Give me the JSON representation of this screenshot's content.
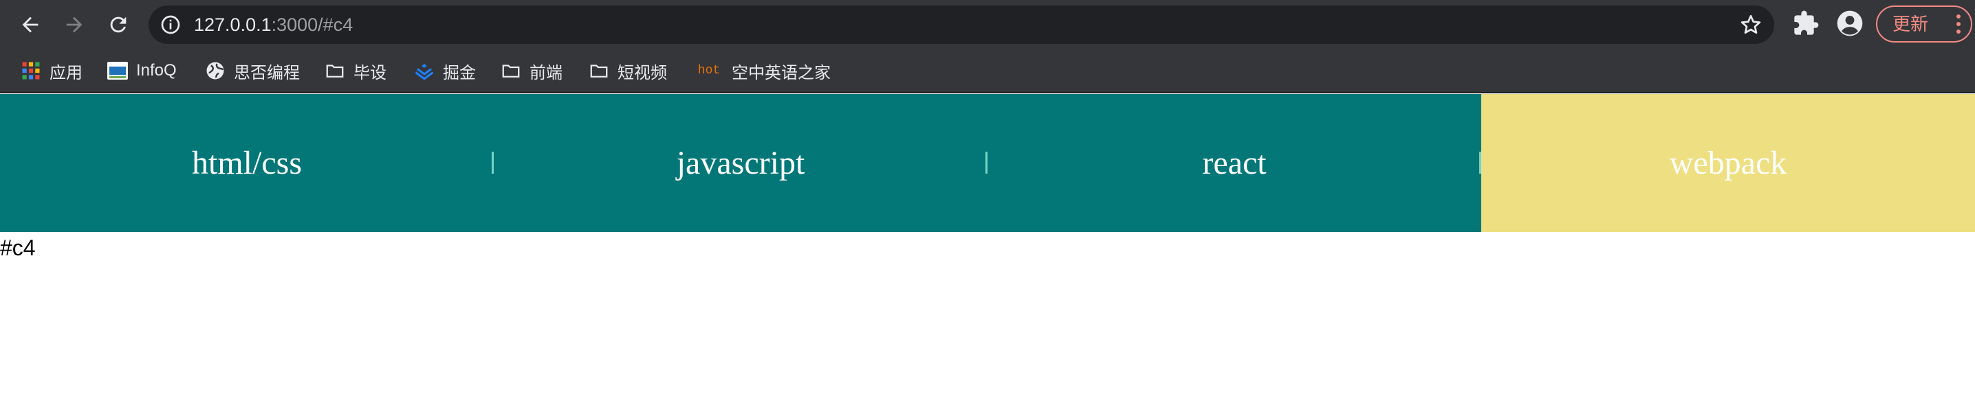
{
  "browser": {
    "url_host": "127.0.0.1",
    "url_rest": ":3000/#c4",
    "update_label": "更新",
    "bookmarks": [
      {
        "label": "应用",
        "icon": "apps-grid-icon"
      },
      {
        "label": "InfoQ",
        "icon": "infoq-icon"
      },
      {
        "label": "思否编程",
        "icon": "globe-icon"
      },
      {
        "label": "毕设",
        "icon": "folder-icon"
      },
      {
        "label": "掘金",
        "icon": "juejin-icon"
      },
      {
        "label": "前端",
        "icon": "folder-icon"
      },
      {
        "label": "短视频",
        "icon": "folder-icon"
      },
      {
        "label": "空中英语之家",
        "icon": "hot-icon",
        "badge": "hot"
      }
    ]
  },
  "nav": {
    "items": [
      {
        "label": "html/css"
      },
      {
        "label": "javascript"
      },
      {
        "label": "react"
      },
      {
        "label": "webpack"
      }
    ],
    "active_index": 3,
    "colors": {
      "default": "#037777",
      "active": "#eee082",
      "separator": "#79d3c8"
    }
  },
  "page": {
    "hash_text": "#c4"
  }
}
